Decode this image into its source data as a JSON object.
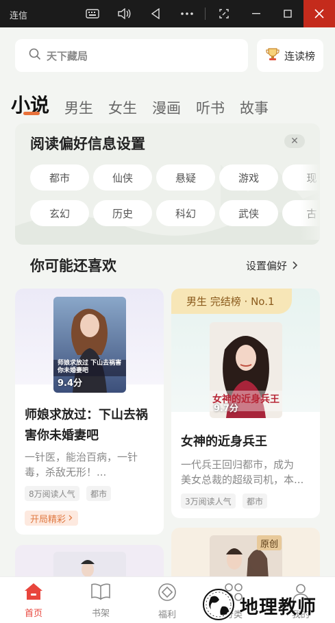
{
  "window": {
    "title": "连信",
    "controls": [
      "keyboard-icon",
      "volume-icon",
      "back-icon",
      "more-icon",
      "screenshot-icon",
      "minimize-icon",
      "maximize-icon",
      "close-icon"
    ]
  },
  "search": {
    "placeholder": "天下藏局"
  },
  "rank_button": {
    "label": "连读榜"
  },
  "tabs": [
    {
      "label": "小说",
      "active": true
    },
    {
      "label": "男生"
    },
    {
      "label": "女生"
    },
    {
      "label": "漫画"
    },
    {
      "label": "听书"
    },
    {
      "label": "故事"
    }
  ],
  "preferences": {
    "title": "阅读偏好信息设置",
    "row1": [
      "都市",
      "仙侠",
      "悬疑",
      "游戏",
      "现"
    ],
    "row2": [
      "玄幻",
      "历史",
      "科幻",
      "武侠",
      "古"
    ]
  },
  "section": {
    "title": "你可能还喜欢",
    "link": "设置偏好"
  },
  "books": [
    {
      "cover_title": "师娘求放过 下山去祸害你未婚妻吧",
      "score": "9.4分",
      "title_line1": "师娘求放过：下山去祸",
      "title_line2": "害你未婚妻吧",
      "desc_line1": "一针医，能治百病，一针",
      "desc_line2": "毒，杀敌无形！...",
      "readers": "8万阅读人气",
      "genre": "都市",
      "action": "开局精彩"
    },
    {
      "ribbon": "男生 完结榜 · No.1",
      "cover_title": "女神的近身兵王",
      "score": "9.7分",
      "title": "女神的近身兵王",
      "desc_line1": "一代兵王回归都市，成为",
      "desc_line2": "美女总裁的超级司机，本...",
      "readers": "3万阅读人气",
      "genre": "都市"
    },
    {
      "badge": "原创"
    }
  ],
  "bottom_nav": [
    {
      "label": "首页",
      "icon": "home-icon",
      "active": true
    },
    {
      "label": "书架",
      "icon": "bookshelf-icon"
    },
    {
      "label": "福利",
      "icon": "welfare-icon"
    },
    {
      "label": "分类",
      "icon": "category-icon"
    },
    {
      "label": "我的",
      "icon": "profile-icon"
    }
  ],
  "watermark": {
    "text": "地理教师"
  },
  "colors": {
    "accent": "#e8453c",
    "tab_underline": "#e8713a",
    "close_red": "#c42b1c"
  }
}
